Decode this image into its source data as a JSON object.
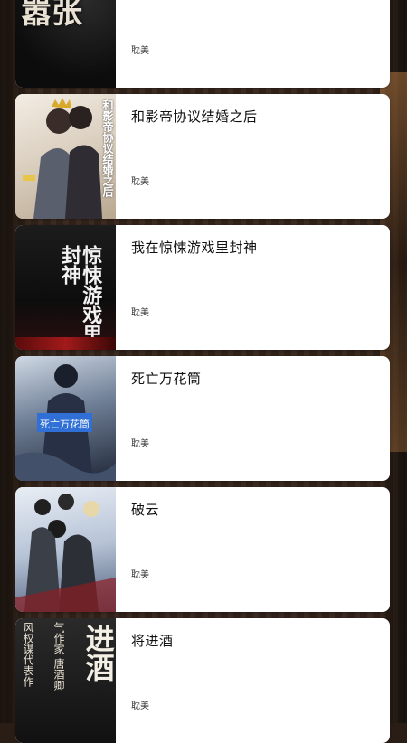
{
  "books": [
    {
      "title": "",
      "category": "耽美",
      "cover_text": "嚣张"
    },
    {
      "title": "和影帝协议结婚之后",
      "category": "耽美",
      "cover_text": "和影帝协议结婚之后"
    },
    {
      "title": "我在惊悚游戏里封神",
      "category": "耽美",
      "cover_text": "惊悚游戏里封神"
    },
    {
      "title": "死亡万花筒",
      "category": "耽美",
      "cover_text": "死亡万花筒"
    },
    {
      "title": "破云",
      "category": "耽美",
      "cover_text": ""
    },
    {
      "title": "将进酒",
      "category": "耽美",
      "cover_text": "进酒",
      "cover_subtext": "风权谋代表作",
      "cover_author": "气作家 唐酒卿"
    }
  ],
  "colors": {
    "card_bg": "#ffffff",
    "title_text": "#111111",
    "category_text": "#333333",
    "page_bg": "#2a1d15"
  }
}
